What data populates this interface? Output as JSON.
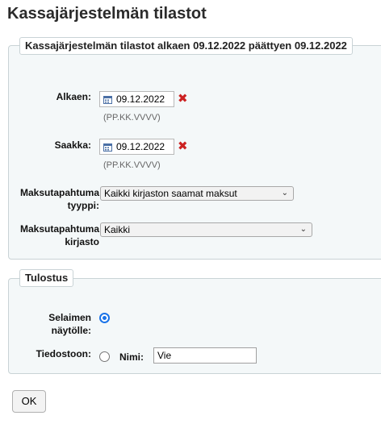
{
  "page": {
    "title": "Kassajärjestelmän tilastot"
  },
  "filters": {
    "legend": "Kassajärjestelmän tilastot alkaen 09.12.2022 päättyen 09.12.2022",
    "from": {
      "label": "Alkaen:",
      "value": "09.12.2022",
      "hint": "(PP.KK.VVVV)",
      "icon": "calendar-icon",
      "clear_icon": "clear-icon"
    },
    "to": {
      "label": "Saakka:",
      "value": "09.12.2022",
      "hint": "(PP.KK.VVVV)",
      "icon": "calendar-icon",
      "clear_icon": "clear-icon"
    },
    "type": {
      "label_line1": "Maksutapahtuma",
      "label_line2": "tyyppi:",
      "selected": "Kaikki kirjaston saamat maksut"
    },
    "library": {
      "label_line1": "Maksutapahtuma",
      "label_line2": "kirjasto",
      "selected": "Kaikki"
    }
  },
  "output": {
    "legend": "Tulostus",
    "browser": {
      "label_line1": "Selaimen",
      "label_line2": "näytölle:",
      "selected": true
    },
    "file": {
      "label": "Tiedostoon:",
      "name_label": "Nimi:",
      "name_value": "Vie",
      "selected": false
    }
  },
  "actions": {
    "ok_label": "OK"
  },
  "colors": {
    "radio_accent": "#1a73e8",
    "clear_icon": "#cc2222"
  }
}
